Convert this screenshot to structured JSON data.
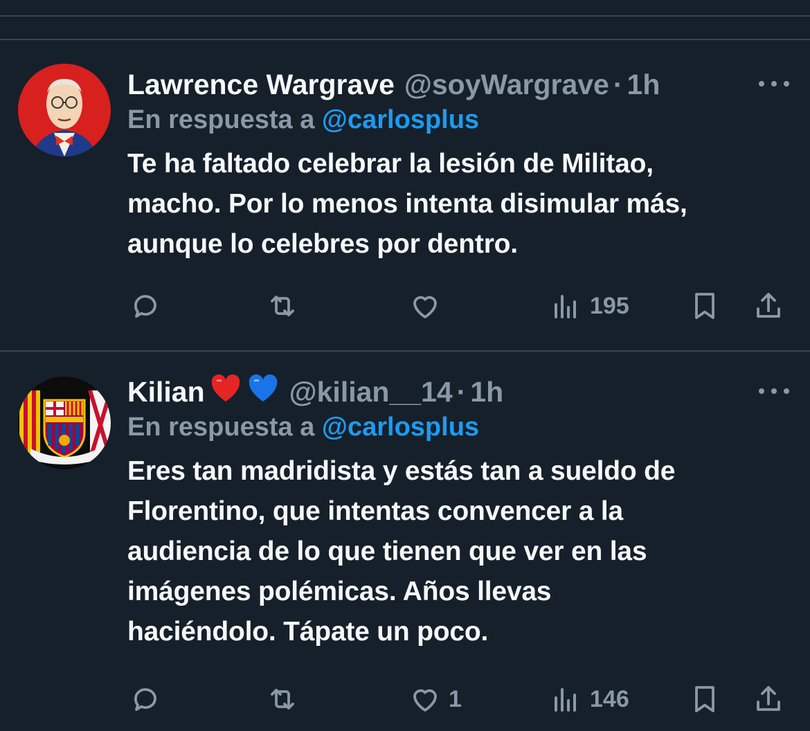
{
  "tweets": [
    {
      "name": "Lawrence Wargrave",
      "handle": "@soyWargrave",
      "separator": "·",
      "time": "1h",
      "reply_prefix": "En respuesta a",
      "reply_to": "@carlosplus",
      "lines": [
        "Te ha faltado celebrar la lesión de Militao,",
        "macho. Por lo menos intenta disimular más,",
        "aunque lo celebres por dentro."
      ],
      "likes": "",
      "views": "195",
      "avatar_icon": "cartoon-man-portrait"
    },
    {
      "name": "Kilian",
      "emojis": [
        "red-heart",
        "blue-heart"
      ],
      "handle": "@kilian__14",
      "separator": "·",
      "time": "1h",
      "reply_prefix": "En respuesta a",
      "reply_to": "@carlosplus",
      "lines": [
        "Eres tan madridista y estás tan a sueldo de",
        "Florentino, que intentas convencer a la",
        "audiencia de lo que tienen que ver en las",
        "imágenes polémicas. Años llevas",
        "haciéndolo. Tápate un poco."
      ],
      "likes": "1",
      "views": "146",
      "avatar_icon": "fc-barcelona-crest"
    }
  ],
  "colors": {
    "background": "#15202b",
    "text": "#f7f9f9",
    "secondary": "#8b98a5",
    "accent": "#1d9bf0",
    "divider": "#38444d"
  },
  "icons": [
    "reply-icon",
    "retweet-icon",
    "like-icon",
    "views-icon",
    "bookmark-icon",
    "share-icon",
    "more-icon"
  ]
}
